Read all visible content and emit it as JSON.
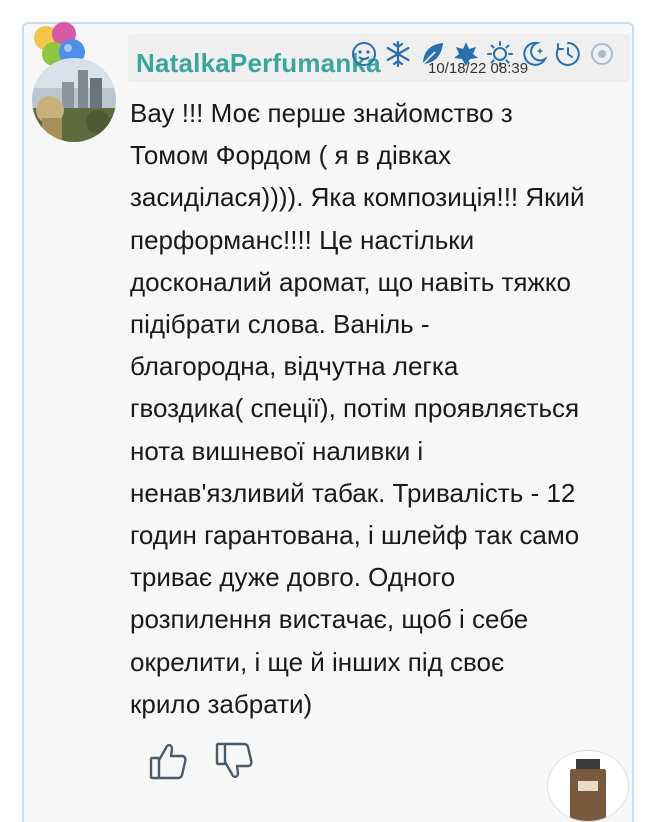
{
  "review": {
    "username": "NatalkaPerfumanka",
    "date": "10/18/22 08:39",
    "text": "Вау !!! Моє перше знайомство з\nТомом Фордом ( я в дівках\nзасиділася)))). Яка композиція!!! Який\nперформанс!!!! Це настільки\nдосконалий аромат, що навіть тяжко\nпідібрати слова. Ваніль -\nблагородна, відчутна легка\nгвоздика( спеції), потім проявляється\nнота вишневої наливки і\nненав'язливий табак. Тривалість - 12\nгодин гарантована, і шлейф так само\nтриває дуже довго. Одного\nрозпилення вистачає, щоб і себе\nокрелити, і ще й інших під своє\nкрило забрати)"
  },
  "season_icons": [
    "winter-icon",
    "snowflake-icon",
    "spring-leaf-icon",
    "autumn-leaf-icon",
    "summer-sun-icon",
    "night-moon-icon",
    "day-clock-icon",
    "more-icon"
  ],
  "votes": {
    "like_icon": "thumbs-up-icon",
    "dislike_icon": "thumbs-down-icon"
  },
  "colors": {
    "username": "#3aa59c",
    "card_border": "#c9dced",
    "icon_blue": "#2a6fb0"
  }
}
